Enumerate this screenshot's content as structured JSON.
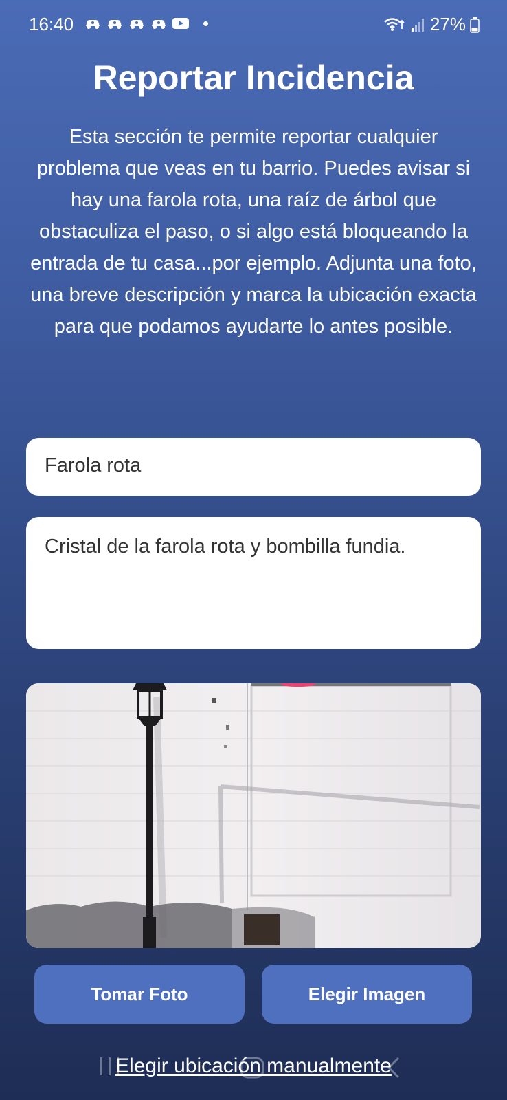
{
  "status_bar": {
    "time": "16:40",
    "battery": "27%",
    "notification_icons": [
      "carpool-icon",
      "carpool-icon",
      "carpool-icon",
      "carpool-icon",
      "youtube-icon"
    ]
  },
  "page": {
    "title": "Reportar Incidencia",
    "description": "Esta sección te permite reportar cualquier problema que veas en tu barrio. Puedes avisar si hay una farola rota, una raíz de árbol que obstaculiza el paso, o si algo está bloqueando la entrada de tu casa...por ejemplo. Adjunta una foto, una breve descripción y marca la ubicación exacta para que podamos ayudarte lo antes posible."
  },
  "form": {
    "title_value": "Farola rota",
    "description_value": "Cristal de la farola rota y bombilla fundia."
  },
  "actions": {
    "take_photo": "Tomar Foto",
    "choose_image": "Elegir Imagen",
    "choose_location": "Elegir ubicación manualmente"
  },
  "colors": {
    "gradient_top": "#4a6bb6",
    "gradient_bottom": "#1e2d55",
    "button": "#4f6fbf"
  }
}
